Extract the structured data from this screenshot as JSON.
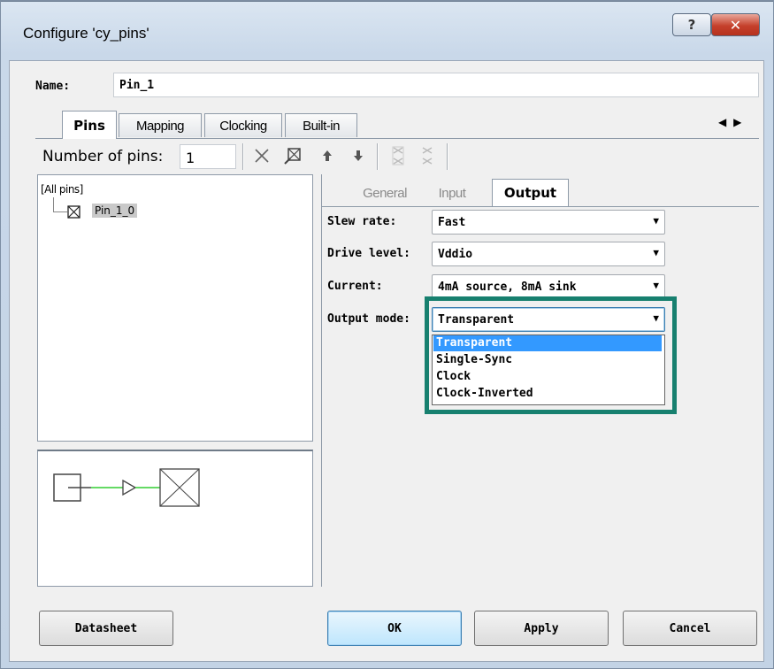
{
  "window": {
    "title": "Configure 'cy_pins'",
    "help_symbol": "?",
    "close_symbol": "✕"
  },
  "name_field": {
    "label": "Name:",
    "value": "Pin_1"
  },
  "tabs": [
    {
      "label": "Pins",
      "active": true
    },
    {
      "label": "Mapping",
      "active": false
    },
    {
      "label": "Clocking",
      "active": false
    },
    {
      "label": "Built-in",
      "active": false
    }
  ],
  "tab_scroll": {
    "left": "◀",
    "right": "▶"
  },
  "toolbar": {
    "num_pins_label": "Number of pins:",
    "num_pins_value": "1",
    "icons": [
      "delete-icon",
      "pin-select-icon",
      "move-up-icon",
      "move-down-icon",
      "merge-icon",
      "split-icon"
    ]
  },
  "tree": {
    "root_label": "[All pins]",
    "pin_label": "Pin_1_0"
  },
  "sub_tabs": [
    {
      "label": "General",
      "active": false
    },
    {
      "label": "Input",
      "active": false
    },
    {
      "label": "Output",
      "active": true
    }
  ],
  "properties": {
    "slew_rate": {
      "label": "Slew rate:",
      "value": "Fast"
    },
    "drive_level": {
      "label": "Drive level:",
      "value": "Vddio"
    },
    "current": {
      "label": "Current:",
      "value": "4mA source, 8mA sink"
    },
    "output_mode": {
      "label": "Output mode:",
      "value": "Transparent"
    }
  },
  "output_mode_options": [
    "Transparent",
    "Single-Sync",
    "Clock",
    "Clock-Inverted"
  ],
  "buttons": {
    "datasheet": "Datasheet",
    "ok": "OK",
    "apply": "Apply",
    "cancel": "Cancel"
  },
  "colors": {
    "highlight_border": "#17806f",
    "selection": "#3399ff",
    "schematic_wire": "#32cd32"
  }
}
